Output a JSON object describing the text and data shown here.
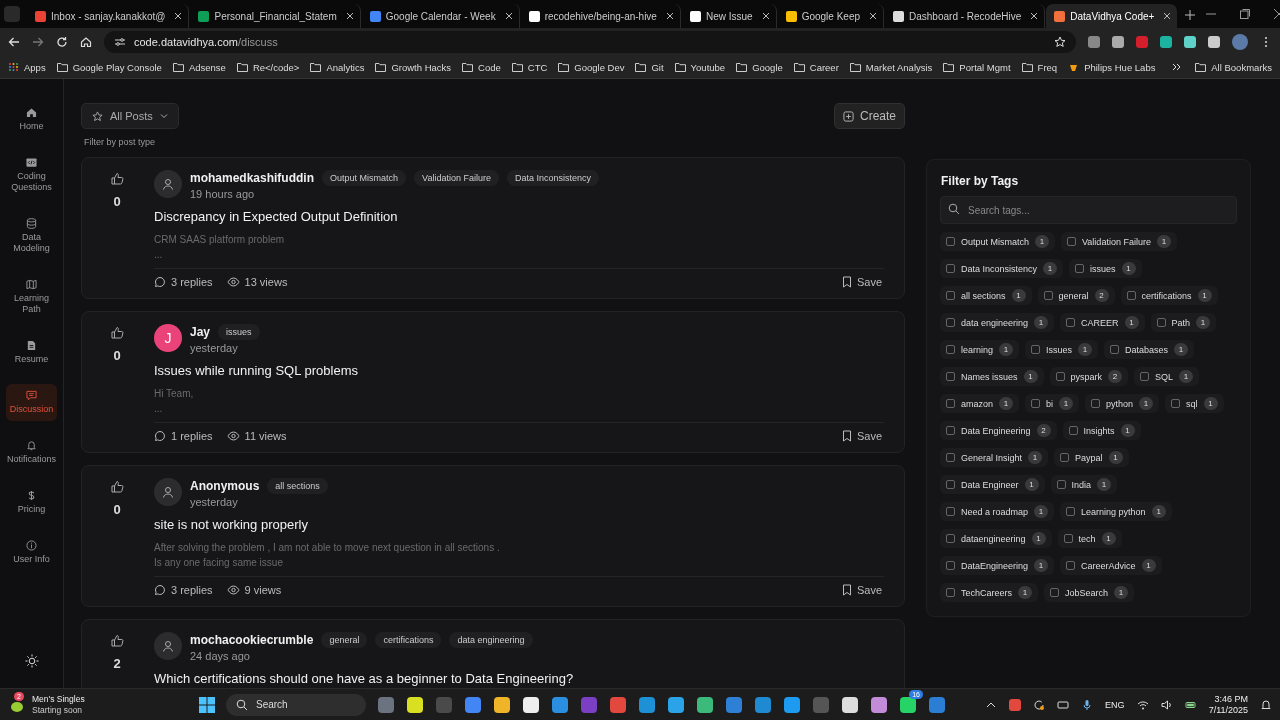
{
  "browser": {
    "tabs": [
      {
        "title": "Inbox - sanjay.kanakkot@",
        "selected": false
      },
      {
        "title": "Personal_Financial_Statem",
        "selected": false
      },
      {
        "title": "Google Calendar - Week",
        "selected": false
      },
      {
        "title": "recodehive/being-an-hive",
        "selected": false
      },
      {
        "title": "New Issue",
        "selected": false
      },
      {
        "title": "Google Keep",
        "selected": false
      },
      {
        "title": "Dashboard - RecodeHive",
        "selected": false
      },
      {
        "title": "DataVidhya Code+",
        "selected": true
      }
    ],
    "url": {
      "host": "code.datavidhya.com",
      "path": "/discuss"
    },
    "bookmarks": [
      {
        "label": "Apps",
        "kind": "apps"
      },
      {
        "label": "Google Play Console",
        "kind": "folder"
      },
      {
        "label": "Adsense",
        "kind": "folder"
      },
      {
        "label": "Re</code>",
        "kind": "folder"
      },
      {
        "label": "Analytics",
        "kind": "folder"
      },
      {
        "label": "Growth Hacks",
        "kind": "folder"
      },
      {
        "label": "Code",
        "kind": "folder"
      },
      {
        "label": "CTC",
        "kind": "folder"
      },
      {
        "label": "Google Dev",
        "kind": "folder"
      },
      {
        "label": "Git",
        "kind": "folder"
      },
      {
        "label": "Youtube",
        "kind": "folder"
      },
      {
        "label": "Google",
        "kind": "folder"
      },
      {
        "label": "Career",
        "kind": "folder"
      },
      {
        "label": "Market Analysis",
        "kind": "folder"
      },
      {
        "label": "Portal Mgmt",
        "kind": "folder"
      },
      {
        "label": "Freq",
        "kind": "folder"
      },
      {
        "label": "Philips Hue Labs",
        "kind": "link"
      }
    ],
    "all_bookmarks": "All Bookmarks"
  },
  "sidebar": {
    "items": [
      {
        "label": "Home",
        "selected": false
      },
      {
        "label": "Coding Questions",
        "selected": false
      },
      {
        "label": "Data Modeling",
        "selected": false
      },
      {
        "label": "Learning Path",
        "selected": false
      },
      {
        "label": "Resume",
        "selected": false
      },
      {
        "label": "Discussion",
        "selected": true
      },
      {
        "label": "Notifications",
        "selected": false
      },
      {
        "label": "Pricing",
        "selected": false
      },
      {
        "label": "User Info",
        "selected": false
      }
    ]
  },
  "toolbar": {
    "filter": "All Posts",
    "filter_hint": "Filter by post type",
    "create": "Create"
  },
  "posts": [
    {
      "votes": "0",
      "author": "mohamedkashifuddin",
      "avatar": {
        "kind": "placeholder"
      },
      "tags": [
        "Output Mismatch",
        "Validation Failure",
        "Data Inconsistency"
      ],
      "time": "19 hours ago",
      "title": "Discrepancy in Expected Output Definition",
      "body": [
        "CRM SAAS platform problem",
        "..."
      ],
      "replies": "3 replies",
      "views": "13 views",
      "save": "Save"
    },
    {
      "votes": "0",
      "author": "Jay",
      "avatar": {
        "kind": "letter",
        "letter": "J",
        "color": "#e9437a"
      },
      "tags": [
        "issues"
      ],
      "time": "yesterday",
      "title": "Issues while running SQL problems",
      "body": [
        "Hi Team,",
        "..."
      ],
      "replies": "1 replies",
      "views": "11 views",
      "save": "Save"
    },
    {
      "votes": "0",
      "author": "Anonymous",
      "avatar": {
        "kind": "placeholder"
      },
      "tags": [
        "all sections"
      ],
      "time": "yesterday",
      "title": "site is not working properly",
      "body": [
        "After solving the problem , I am not able to move next question in all sections .",
        "Is any one facing same issue"
      ],
      "replies": "3 replies",
      "views": "9 views",
      "save": "Save"
    },
    {
      "votes": "2",
      "author": "mochacookiecrumble",
      "avatar": {
        "kind": "placeholder"
      },
      "tags": [
        "general",
        "certifications",
        "data engineering"
      ],
      "time": "24 days ago",
      "title": "Which certifications should one have as a beginner to Data Engineering?"
    }
  ],
  "tag_filter": {
    "title": "Filter by Tags",
    "placeholder": "Search tags...",
    "tags": [
      {
        "name": "Output Mismatch",
        "count": "1",
        "checked": false
      },
      {
        "name": "Validation Failure",
        "count": "1",
        "checked": false
      },
      {
        "name": "Data Inconsistency",
        "count": "1",
        "checked": false
      },
      {
        "name": "issues",
        "count": "1",
        "checked": false
      },
      {
        "name": "all sections",
        "count": "1",
        "checked": false
      },
      {
        "name": "general",
        "count": "2",
        "checked": false
      },
      {
        "name": "certifications",
        "count": "1",
        "checked": false
      },
      {
        "name": "data engineering",
        "count": "1",
        "checked": false
      },
      {
        "name": "CAREER",
        "count": "1",
        "checked": false
      },
      {
        "name": "Path",
        "count": "1",
        "checked": false
      },
      {
        "name": "learning",
        "count": "1",
        "checked": false
      },
      {
        "name": "Issues",
        "count": "1",
        "checked": false
      },
      {
        "name": "Databases",
        "count": "1",
        "checked": false
      },
      {
        "name": "Names issues",
        "count": "1",
        "checked": false
      },
      {
        "name": "pyspark",
        "count": "2",
        "checked": false
      },
      {
        "name": "SQL",
        "count": "1",
        "checked": false
      },
      {
        "name": "amazon",
        "count": "1",
        "checked": false
      },
      {
        "name": "bi",
        "count": "1",
        "checked": false
      },
      {
        "name": "python",
        "count": "1",
        "checked": false
      },
      {
        "name": "sql",
        "count": "1",
        "checked": false
      },
      {
        "name": "Data Engineering",
        "count": "2",
        "checked": false
      },
      {
        "name": "Insights",
        "count": "1",
        "checked": false
      },
      {
        "name": "General Insight",
        "count": "1",
        "checked": false
      },
      {
        "name": "Paypal",
        "count": "1",
        "checked": false
      },
      {
        "name": "Data Engineer",
        "count": "1",
        "checked": false
      },
      {
        "name": "India",
        "count": "1",
        "checked": false
      },
      {
        "name": "Need a roadmap",
        "count": "1",
        "checked": false
      },
      {
        "name": "Learning python",
        "count": "1",
        "checked": false
      },
      {
        "name": "dataengineering",
        "count": "1",
        "checked": false
      },
      {
        "name": "tech",
        "count": "1",
        "checked": false
      },
      {
        "name": "DataEngineering",
        "count": "1",
        "checked": false
      },
      {
        "name": "CareerAdvice",
        "count": "1",
        "checked": false
      },
      {
        "name": "TechCareers",
        "count": "1",
        "checked": false
      },
      {
        "name": "JobSearch",
        "count": "1",
        "checked": false
      }
    ]
  },
  "taskbar": {
    "widget": {
      "badge": "2",
      "title": "Men's Singles",
      "subtitle": "Starting soon"
    },
    "search_placeholder": "Search",
    "chat_badge": "16",
    "language": "ENG",
    "time": "3:46 PM",
    "date": "7/11/2025"
  }
}
